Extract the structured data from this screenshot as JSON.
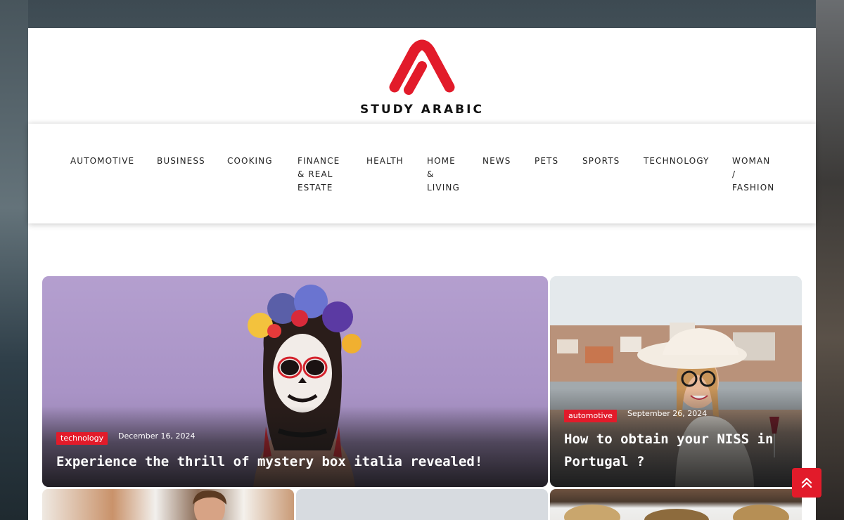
{
  "site": {
    "logo_text": "STUDY ARABIC",
    "brand_color": "#e21b2a"
  },
  "nav": {
    "items": [
      {
        "label_lines": [
          "AUTOMOTIVE"
        ]
      },
      {
        "label_lines": [
          "BUSINESS"
        ]
      },
      {
        "label_lines": [
          "COOKING"
        ]
      },
      {
        "label_lines": [
          "FINANCE",
          "& REAL",
          "ESTATE"
        ]
      },
      {
        "label_lines": [
          "HEALTH"
        ]
      },
      {
        "label_lines": [
          "HOME",
          "&",
          "LIVING"
        ]
      },
      {
        "label_lines": [
          "NEWS"
        ]
      },
      {
        "label_lines": [
          "PETS"
        ]
      },
      {
        "label_lines": [
          "SPORTS"
        ]
      },
      {
        "label_lines": [
          "TECHNOLOGY"
        ]
      },
      {
        "label_lines": [
          "WOMAN",
          "/",
          "FASHION"
        ]
      }
    ]
  },
  "featured": {
    "main": {
      "category": "technology",
      "date": "December 16, 2024",
      "title": "Experience the thrill of mystery box italia revealed!"
    },
    "side": {
      "category": "automotive",
      "date": "September 26, 2024",
      "title_lines": [
        "How to obtain your NISS in",
        "Portugal ?"
      ]
    }
  },
  "scroll_top": {
    "icon": "double-chevron-up-icon"
  }
}
